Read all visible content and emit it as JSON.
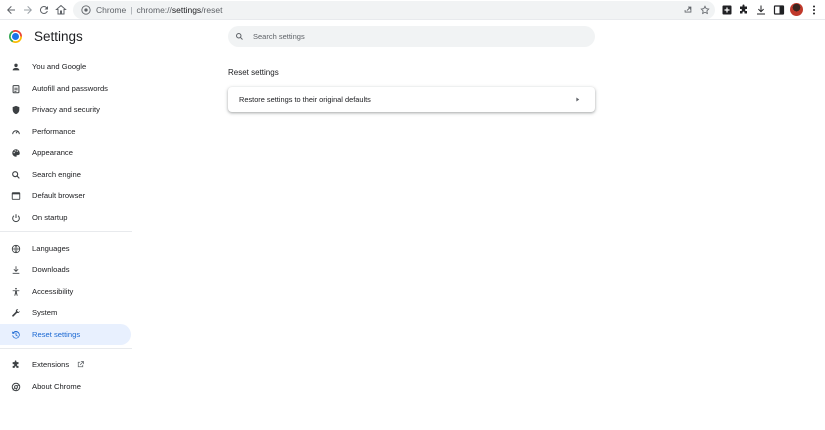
{
  "browser": {
    "omnibox": {
      "origin_label": "Chrome",
      "url_scheme": "chrome://",
      "url_host": "settings",
      "url_path": "/reset"
    }
  },
  "header": {
    "title": "Settings",
    "search_placeholder": "Search settings"
  },
  "sidebar": {
    "items": [
      {
        "label": "You and Google",
        "icon": "person-icon"
      },
      {
        "label": "Autofill and passwords",
        "icon": "clipboard-icon"
      },
      {
        "label": "Privacy and security",
        "icon": "shield-icon"
      },
      {
        "label": "Performance",
        "icon": "speedometer-icon"
      },
      {
        "label": "Appearance",
        "icon": "palette-icon"
      },
      {
        "label": "Search engine",
        "icon": "search-icon"
      },
      {
        "label": "Default browser",
        "icon": "browser-window-icon"
      },
      {
        "label": "On startup",
        "icon": "power-icon"
      },
      {
        "label": "Languages",
        "icon": "globe-icon"
      },
      {
        "label": "Downloads",
        "icon": "download-icon"
      },
      {
        "label": "Accessibility",
        "icon": "accessibility-icon"
      },
      {
        "label": "System",
        "icon": "wrench-icon"
      },
      {
        "label": "Reset settings",
        "icon": "history-icon",
        "active": true
      },
      {
        "label": "Extensions",
        "icon": "puzzle-icon"
      },
      {
        "label": "About Chrome",
        "icon": "chrome-icon"
      }
    ]
  },
  "main": {
    "section_title": "Reset settings",
    "card": {
      "row_label": "Restore settings to their original defaults"
    }
  },
  "colors": {
    "accent": "#1967d2",
    "active_bg": "#e8f0fe",
    "omnibox_bg": "#f1f3f4"
  }
}
